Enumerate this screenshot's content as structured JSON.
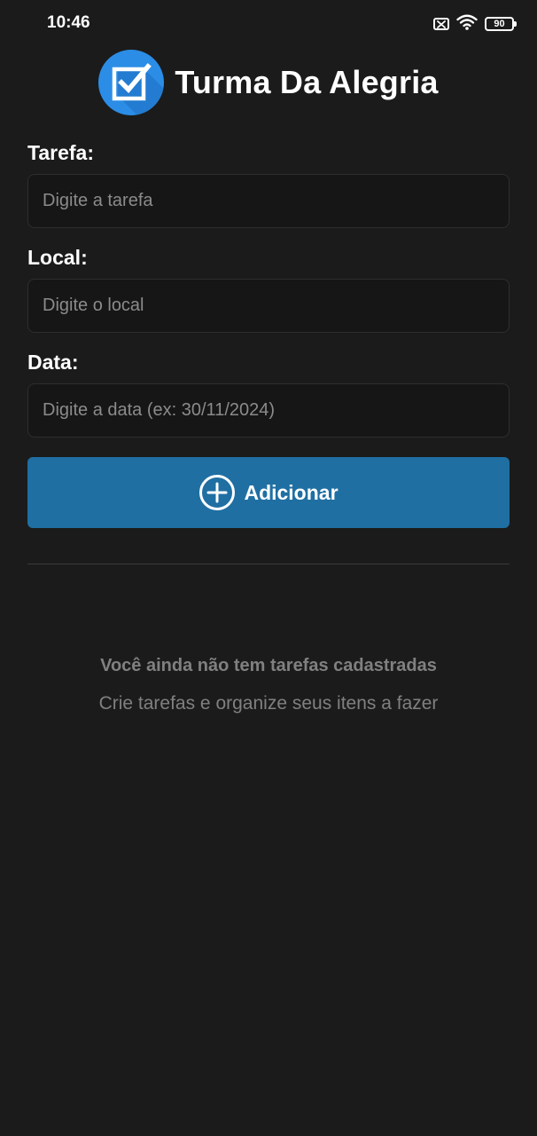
{
  "status_bar": {
    "time": "10:46",
    "battery_level": "90",
    "icons": [
      "sim-off-icon",
      "wifi-icon",
      "battery-icon"
    ]
  },
  "header": {
    "title": "Turma Da Alegria",
    "logo_icon": "checkbox-check-icon"
  },
  "form": {
    "task_label": "Tarefa:",
    "task_placeholder": "Digite a tarefa",
    "task_value": "",
    "location_label": "Local:",
    "location_placeholder": "Digite o local",
    "location_value": "",
    "date_label": "Data:",
    "date_placeholder": "Digite a data (ex: 30/11/2024)",
    "date_value": "",
    "add_button_label": "Adicionar",
    "add_button_icon": "plus-circle-icon"
  },
  "empty_state": {
    "title": "Você ainda não tem tarefas cadastradas",
    "subtitle": "Crie tarefas e organize seus itens a fazer"
  },
  "colors": {
    "background": "#1b1b1b",
    "accent": "#1f6fa3",
    "logo": "#2b8de6",
    "muted_text": "#808080"
  }
}
